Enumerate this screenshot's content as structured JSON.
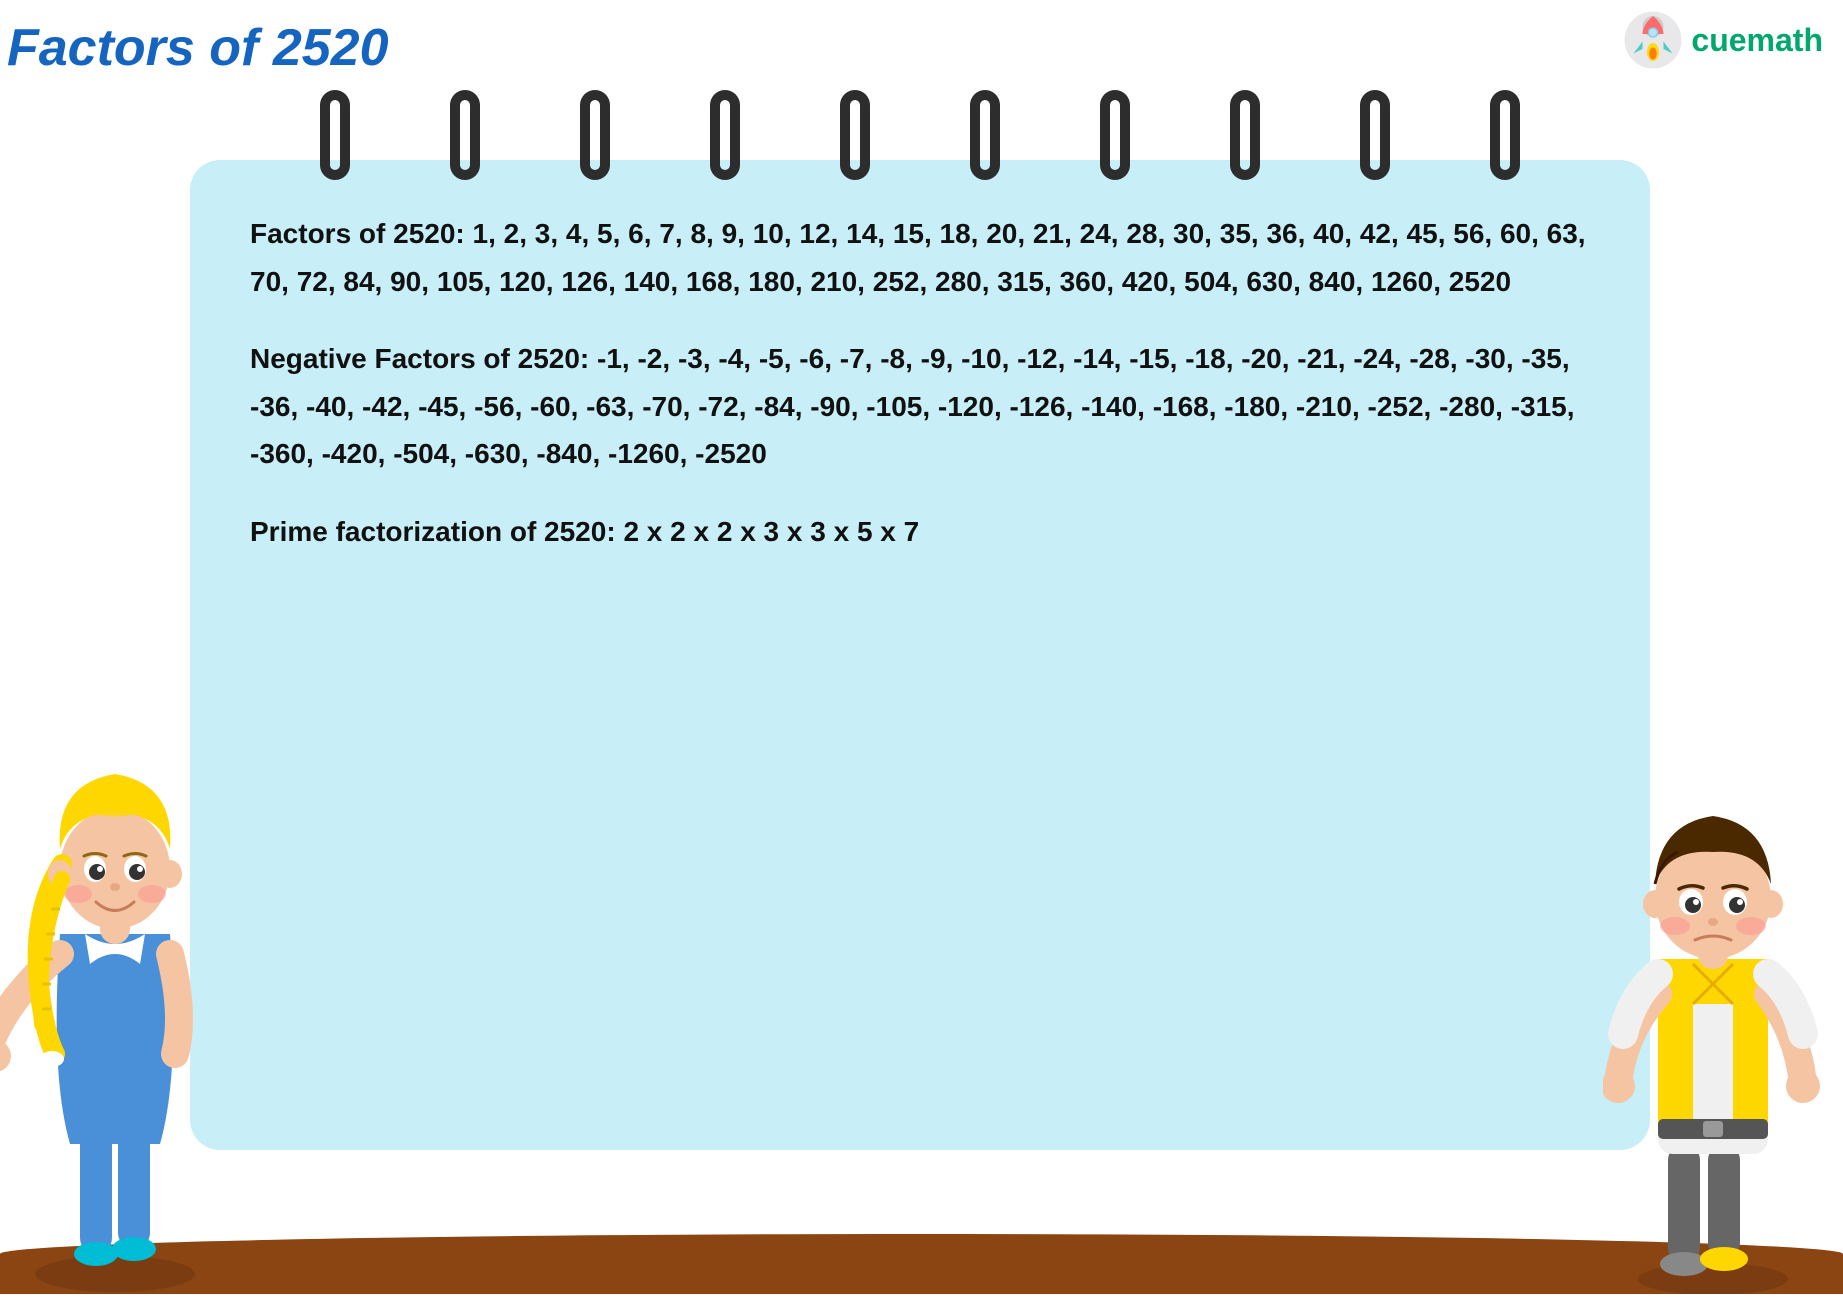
{
  "page": {
    "title": "Factors of 2520",
    "background_color": "#ffffff"
  },
  "header": {
    "title": "Factors of 2520",
    "logo_text": "cuemath"
  },
  "notebook": {
    "factors_label": "Factors of 2520:",
    "factors_values": "1, 2, 3, 4, 5, 6, 7, 8, 9, 10, 12, 14, 15, 18, 20, 21, 24, 28, 30, 35, 36, 40, 42, 45, 56, 60, 63, 70, 72, 84, 90, 105, 120, 126, 140, 168, 180, 210, 252, 280, 315, 360, 420, 504, 630, 840, 1260, 2520",
    "negative_label": "Negative Factors of 2520:",
    "negative_values": "-1, -2, -3, -4, -5, -6, -7, -8, -9, -10, -12, -14, -15, -18, -20, -21, -24, -28, -30, -35, -36, -40, -42, -45, -56, -60, -63, -70, -72, -84, -90, -105, -120, -126, -140, -168, -180, -210, -252, -280, -315, -360, -420, -504, -630, -840, -1260, -2520",
    "prime_label": "Prime factorization of 2520:",
    "prime_values": "2 x 2 x 2 x 3 x 3 x 5 x 7"
  }
}
